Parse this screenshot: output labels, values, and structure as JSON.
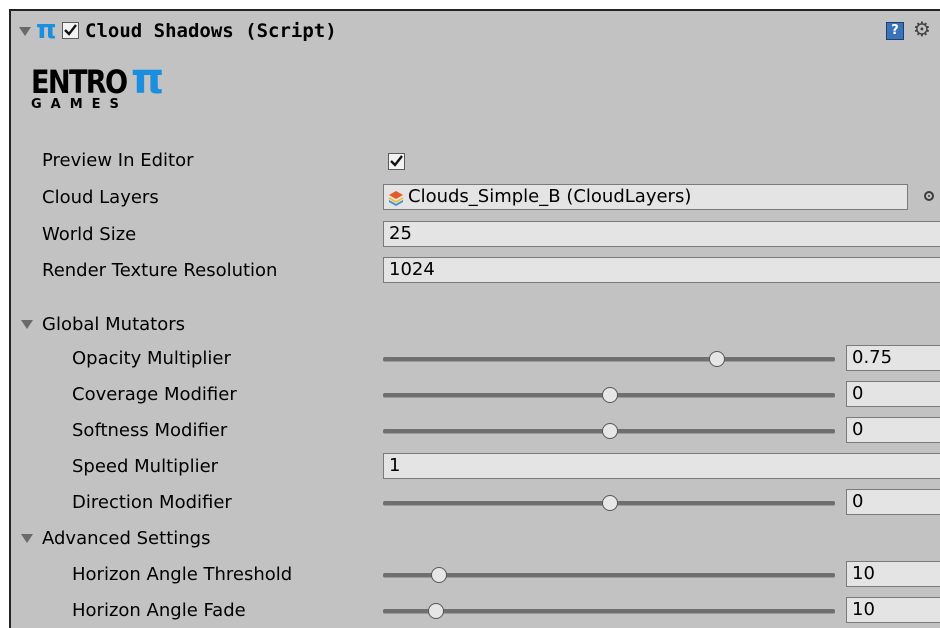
{
  "header": {
    "title": "Cloud Shadows (Script)",
    "enabled": true,
    "icon": "pi-script-icon",
    "help_icon": "help-icon",
    "settings_icon": "gear-icon"
  },
  "logo": {
    "line1": "ENTRO",
    "pi": "π",
    "line2": "GAMES"
  },
  "props": {
    "preview_label": "Preview In Editor",
    "preview_checked": true,
    "cloud_layers_label": "Cloud Layers",
    "cloud_layers_value": "Clouds_Simple_B (CloudLayers)",
    "world_size_label": "World Size",
    "world_size_value": "25",
    "rtr_label": "Render Texture Resolution",
    "rtr_value": "1024"
  },
  "global": {
    "title": "Global Mutators",
    "opacity_label": "Opacity Multiplier",
    "opacity_value": "0.75",
    "opacity_fraction": 0.75,
    "coverage_label": "Coverage Modifier",
    "coverage_value": "0",
    "coverage_fraction": 0.5,
    "softness_label": "Softness Modifier",
    "softness_value": "0",
    "softness_fraction": 0.5,
    "speed_label": "Speed Multiplier",
    "speed_value": "1",
    "direction_label": "Direction Modifier",
    "direction_value": "0",
    "direction_fraction": 0.5
  },
  "advanced": {
    "title": "Advanced Settings",
    "threshold_label": "Horizon Angle Threshold",
    "threshold_value": "10",
    "threshold_fraction": 0.12,
    "fade_label": "Horizon Angle Fade",
    "fade_value": "10",
    "fade_fraction": 0.11
  },
  "colors": {
    "panel": "#c2c2c2",
    "accent": "#1c8ee0",
    "field": "#e4e4e4"
  }
}
